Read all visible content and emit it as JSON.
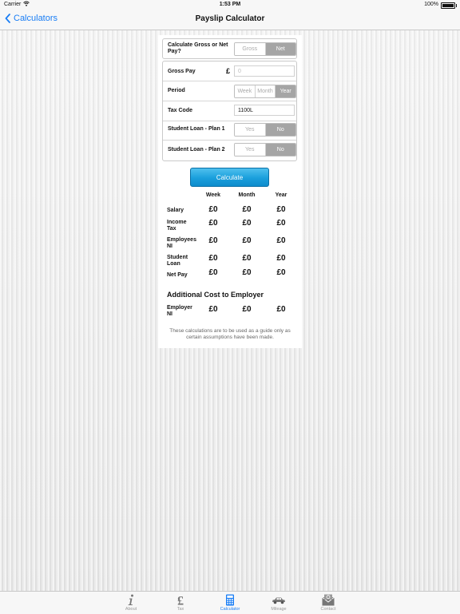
{
  "status_bar": {
    "carrier": "Carrier",
    "time": "1:53 PM",
    "battery": "100%"
  },
  "nav": {
    "back_label": "Calculators",
    "title": "Payslip Calculator"
  },
  "form": {
    "calc_type": {
      "label": "Calculate Gross or Net Pay?",
      "options": [
        "Gross",
        "Net"
      ],
      "selected": "Net"
    },
    "gross_pay": {
      "label": "Gross Pay",
      "currency": "£",
      "placeholder": "0"
    },
    "period": {
      "label": "Period",
      "options": [
        "Week",
        "Month",
        "Year"
      ],
      "selected": "Year"
    },
    "tax_code": {
      "label": "Tax Code",
      "value": "1100L"
    },
    "student_loan_1": {
      "label": "Student Loan - Plan 1",
      "options": [
        "Yes",
        "No"
      ],
      "selected": "No"
    },
    "student_loan_2": {
      "label": "Student Loan - Plan 2",
      "options": [
        "Yes",
        "No"
      ],
      "selected": "No"
    }
  },
  "calculate_label": "Calculate",
  "results": {
    "columns": [
      "Week",
      "Month",
      "Year"
    ],
    "rows": [
      {
        "label": "Salary",
        "values": [
          "£0",
          "£0",
          "£0"
        ]
      },
      {
        "label": "Income Tax",
        "values": [
          "£0",
          "£0",
          "£0"
        ]
      },
      {
        "label": "Employees NI",
        "values": [
          "£0",
          "£0",
          "£0"
        ]
      },
      {
        "label": "Student Loan",
        "values": [
          "£0",
          "£0",
          "£0"
        ]
      },
      {
        "label": "Net Pay",
        "values": [
          "£0",
          "£0",
          "£0"
        ]
      }
    ]
  },
  "employer": {
    "title": "Additional Cost to Employer",
    "row": {
      "label": "Employer NI",
      "values": [
        "£0",
        "£0",
        "£0"
      ]
    }
  },
  "disclaimer": "These calculations are to be used as a guide only as certain assumptions have been made.",
  "tabs": [
    {
      "label": "About",
      "icon": "info-icon"
    },
    {
      "label": "Tax",
      "icon": "pound-icon"
    },
    {
      "label": "Calculator",
      "icon": "calculator-icon",
      "active": true
    },
    {
      "label": "Mileage",
      "icon": "car-icon"
    },
    {
      "label": "Contact",
      "icon": "envelope-icon"
    }
  ],
  "colors": {
    "accent": "#1a7ef5",
    "button": "#1a9fdc",
    "segment_selected": "#a5a5a5"
  }
}
